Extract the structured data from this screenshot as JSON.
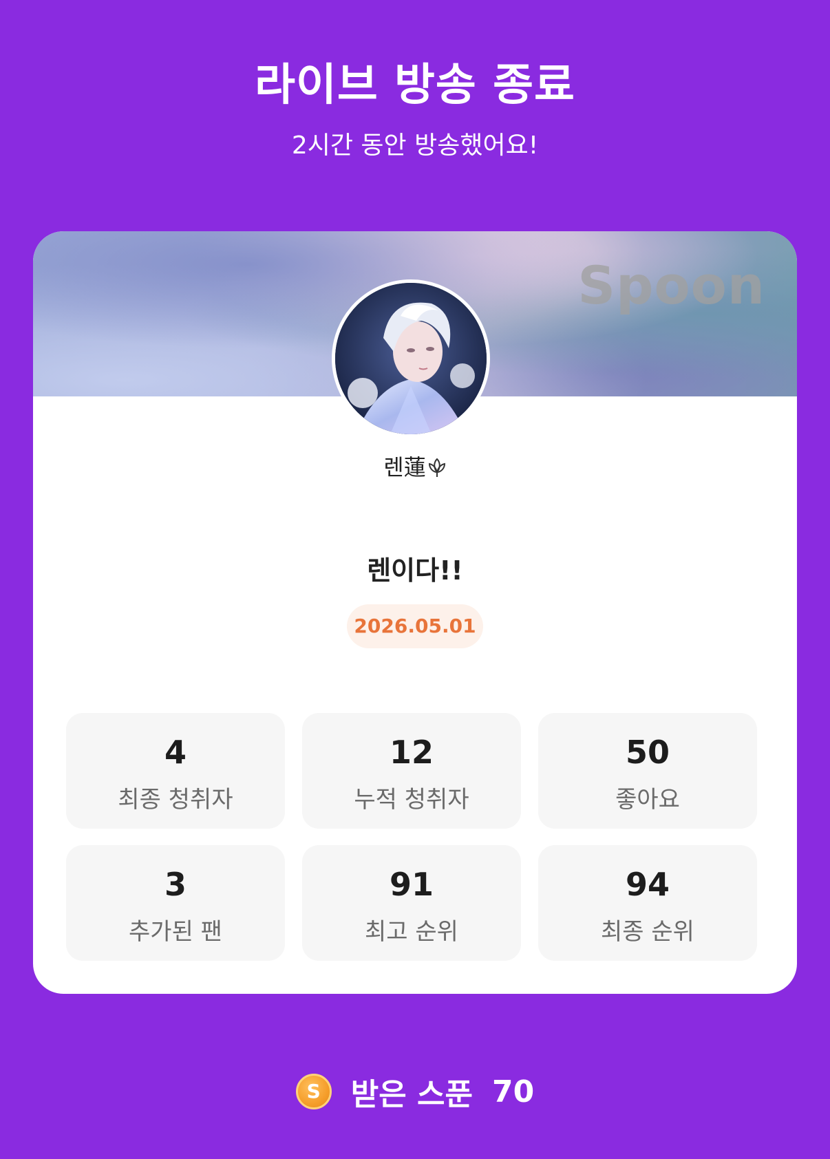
{
  "header": {
    "title": "라이브 방송 종료",
    "subtitle": "2시간 동안 방송했어요!"
  },
  "card": {
    "brand_logo": "Spoon",
    "nickname": "렌蓮",
    "nickname_icon": "lotus-icon",
    "broadcast_title": "렌이다!!",
    "date": "2026.05.01"
  },
  "stats": [
    {
      "value": "4",
      "label": "최종 청취자"
    },
    {
      "value": "12",
      "label": "누적 청취자"
    },
    {
      "value": "50",
      "label": "좋아요"
    },
    {
      "value": "3",
      "label": "추가된 팬"
    },
    {
      "value": "91",
      "label": "최고 순위"
    },
    {
      "value": "94",
      "label": "최종 순위"
    }
  ],
  "footer": {
    "coin_icon": "spoon-coin-icon",
    "coin_letter": "S",
    "label": "받은 스푼",
    "value": "70"
  },
  "colors": {
    "background": "#8a2be0",
    "card": "#ffffff",
    "date_text": "#e8743a",
    "date_badge": "#fdf1ea",
    "stat_tile": "#f6f6f6"
  }
}
